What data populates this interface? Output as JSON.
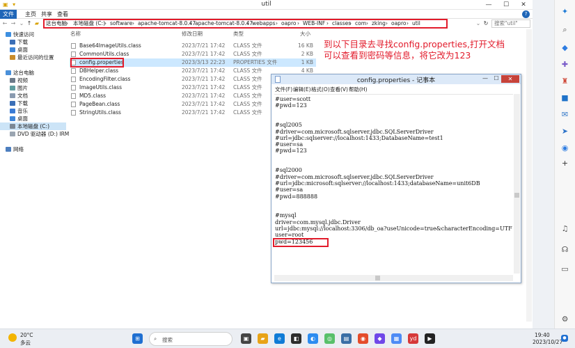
{
  "explorer": {
    "title": "util",
    "ribbon_tabs": [
      "文件",
      "主页",
      "共享",
      "查看"
    ],
    "breadcrumb": [
      "这台电脑",
      "本地磁盘 (C:)",
      "software",
      "apache-tomcat-8.0.47",
      "apache-tomcat-8.0.47",
      "webapps",
      "oapro",
      "WEB-INF",
      "classes",
      "com",
      "zking",
      "oapro",
      "util"
    ],
    "search_placeholder": "搜索\"util\"",
    "columns": {
      "name": "名称",
      "date": "修改日期",
      "type": "类型",
      "size": "大小"
    },
    "files": [
      {
        "name": "Base64ImageUtils.class",
        "date": "2023/7/21 17:42",
        "type": "CLASS 文件",
        "size": "16 KB"
      },
      {
        "name": "CommonUtils.class",
        "date": "2023/7/21 17:42",
        "type": "CLASS 文件",
        "size": "2 KB"
      },
      {
        "name": "config.properties",
        "date": "2023/3/13 22:23",
        "type": "PROPERTIES 文件",
        "size": "1 KB"
      },
      {
        "name": "DBHelper.class",
        "date": "2023/7/21 17:42",
        "type": "CLASS 文件",
        "size": "4 KB"
      },
      {
        "name": "EncodingFilter.class",
        "date": "2023/7/21 17:42",
        "type": "CLASS 文件",
        "size": ""
      },
      {
        "name": "ImageUtils.class",
        "date": "2023/7/21 17:42",
        "type": "CLASS 文件",
        "size": ""
      },
      {
        "name": "MD5.class",
        "date": "2023/7/21 17:42",
        "type": "CLASS 文件",
        "size": ""
      },
      {
        "name": "PageBean.class",
        "date": "2023/7/21 17:42",
        "type": "CLASS 文件",
        "size": ""
      },
      {
        "name": "StringUtils.class",
        "date": "2023/7/21 17:42",
        "type": "CLASS 文件",
        "size": ""
      }
    ],
    "nav_items": [
      "快速访问",
      "下载",
      "桌面",
      "最近访问的位置",
      "这台电脑",
      "视频",
      "图片",
      "文档",
      "下载",
      "音乐",
      "桌面",
      "本地磁盘 (C:)",
      "DVD 驱动器 (D:) IRM",
      "网络"
    ]
  },
  "annotation": {
    "line1": "到以下目录去寻找config.properties,打开文档",
    "line2": "可以查看到密码等信息，将它改为123"
  },
  "notepad": {
    "title": "config.properties - 记事本",
    "menu": [
      "文件(F)",
      "编辑(E)",
      "格式(O)",
      "查看(V)",
      "帮助(H)"
    ],
    "lines": [
      "#user=scott",
      "#pwd=123",
      "",
      "",
      "#sql2005",
      "#driver=com.microsoft.sqlserver.jdbc.SQLServerDriver",
      "#url=jdbc:sqlserver://localhost:1433;DatabaseName=test1",
      "#user=sa",
      "#pwd=123",
      "",
      "",
      "#sql2000",
      "#driver=com.microsoft.sqlserver.jdbc.SQLServerDriver",
      "#url=jdbc:microsoft:sqlserver://localhost:1433;databaseName=unit6DB",
      "#user=sa",
      "#pwd=888888",
      "",
      "",
      "#mysql",
      "driver=com.mysql.jdbc.Driver",
      "url=jdbc:mysql://localhost:3306/db_oa?useUnicode=true&characterEncoding=UTF",
      "user=root",
      "pwd=123456"
    ]
  },
  "taskbar": {
    "temperature": "20°C",
    "weather": "多云",
    "search_label": "搜索",
    "time": "19:40",
    "date": "2023/10/27"
  },
  "colors": {
    "highlight": "#e21b2b",
    "accent": "#1f66b8"
  }
}
